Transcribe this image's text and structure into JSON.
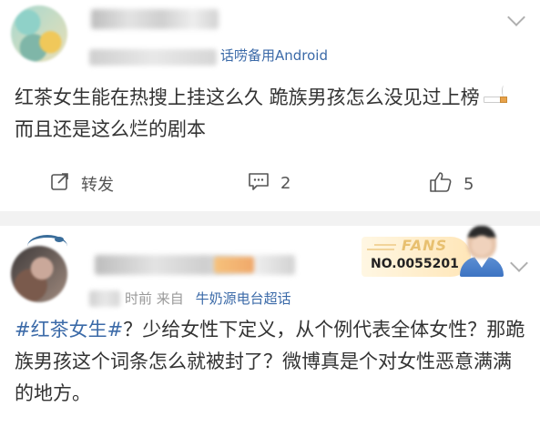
{
  "posts": [
    {
      "meta": {
        "source_prefix": "",
        "source": "话唠备用Android"
      },
      "text": "红茶女生能在热搜上挂这么久 跪族男孩怎么没见过上榜",
      "text_tail": " 而且还是这么烂的剧本",
      "actions": {
        "repost_label": "转发",
        "comment_count": "2",
        "like_count": "5"
      }
    },
    {
      "meta": {
        "time_suffix": "时前",
        "from_label": "来自",
        "source": "牛奶源电台超话"
      },
      "hashtag": "#红茶女生#",
      "text": "？少给女性下定义，从个例代表全体女性？那跪族男孩这个词条怎么就被封了？微博真是个对女性恶意满满的地方。",
      "badge": {
        "fans_label": "FANS",
        "number": "NO.0055201"
      }
    }
  ],
  "colors": {
    "link_blue": "#3b6aa8",
    "meta_gray": "#999999",
    "text_dark": "#333333",
    "divider": "#f2f2f2"
  },
  "icons": {
    "repost": "repost-icon",
    "comment": "comment-icon",
    "like": "thumbs-up-icon",
    "more": "chevron-down-icon"
  }
}
